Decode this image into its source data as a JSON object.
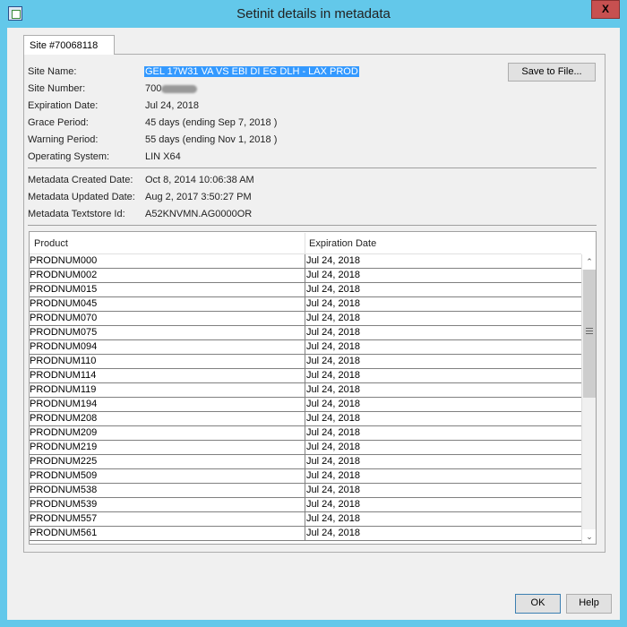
{
  "window": {
    "title": "Setinit details in metadata",
    "close_label": "X"
  },
  "tab": {
    "label": "Site #70068118"
  },
  "fields": [
    {
      "label": "Site Name:",
      "value": "GEL 17W31 VA VS EBI DI EG DLH - LAX PROD"
    },
    {
      "label": "Site Number:",
      "value": "700"
    },
    {
      "label": "Expiration Date:",
      "value": "Jul 24, 2018"
    },
    {
      "label": "Grace Period:",
      "value": "45 days (ending Sep 7, 2018 )"
    },
    {
      "label": "Warning Period:",
      "value": "55 days (ending Nov 1, 2018 )"
    },
    {
      "label": "Operating System:",
      "value": "LIN X64"
    }
  ],
  "metadata": [
    {
      "label": "Metadata Created Date:",
      "value": "Oct 8, 2014 10:06:38 AM"
    },
    {
      "label": "Metadata Updated Date:",
      "value": "Aug 2, 2017 3:50:27 PM"
    },
    {
      "label": "Metadata Textstore Id:",
      "value": "A52KNVMN.AG0000OR"
    }
  ],
  "save_button": "Save to File...",
  "table": {
    "columns": [
      "Product",
      "Expiration Date"
    ],
    "rows": [
      [
        "PRODNUM000",
        "Jul 24, 2018"
      ],
      [
        "PRODNUM002",
        "Jul 24, 2018"
      ],
      [
        "PRODNUM015",
        "Jul 24, 2018"
      ],
      [
        "PRODNUM045",
        "Jul 24, 2018"
      ],
      [
        "PRODNUM070",
        "Jul 24, 2018"
      ],
      [
        "PRODNUM075",
        "Jul 24, 2018"
      ],
      [
        "PRODNUM094",
        "Jul 24, 2018"
      ],
      [
        "PRODNUM110",
        "Jul 24, 2018"
      ],
      [
        "PRODNUM114",
        "Jul 24, 2018"
      ],
      [
        "PRODNUM119",
        "Jul 24, 2018"
      ],
      [
        "PRODNUM194",
        "Jul 24, 2018"
      ],
      [
        "PRODNUM208",
        "Jul 24, 2018"
      ],
      [
        "PRODNUM209",
        "Jul 24, 2018"
      ],
      [
        "PRODNUM219",
        "Jul 24, 2018"
      ],
      [
        "PRODNUM225",
        "Jul 24, 2018"
      ],
      [
        "PRODNUM509",
        "Jul 24, 2018"
      ],
      [
        "PRODNUM538",
        "Jul 24, 2018"
      ],
      [
        "PRODNUM539",
        "Jul 24, 2018"
      ],
      [
        "PRODNUM557",
        "Jul 24, 2018"
      ],
      [
        "PRODNUM561",
        "Jul 24, 2018"
      ]
    ]
  },
  "buttons": {
    "ok": "OK",
    "help": "Help"
  }
}
